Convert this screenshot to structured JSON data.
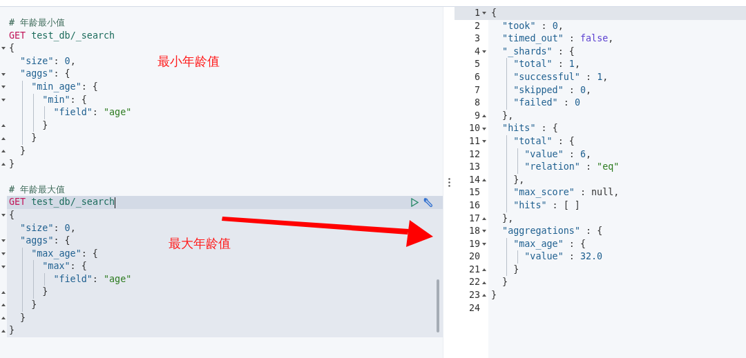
{
  "console": {
    "requests": [
      {
        "comment": "# 年龄最小值",
        "method": "GET",
        "path": "test_db/_search",
        "selected": false,
        "body": [
          [
            {
              "kind": "punct",
              "text": "{"
            }
          ],
          [
            {
              "kind": "key",
              "text": "\"size\""
            },
            {
              "kind": "punct",
              "text": ": "
            },
            {
              "kind": "number",
              "text": "0"
            },
            {
              "kind": "punct",
              "text": ","
            }
          ],
          [
            {
              "kind": "key",
              "text": "\"aggs\""
            },
            {
              "kind": "punct",
              "text": ": {"
            }
          ],
          [
            {
              "kind": "key",
              "text": "\"min_age\""
            },
            {
              "kind": "punct",
              "text": ": {"
            }
          ],
          [
            {
              "kind": "key",
              "text": "\"min\""
            },
            {
              "kind": "punct",
              "text": ": {"
            }
          ],
          [
            {
              "kind": "key",
              "text": "\"field\""
            },
            {
              "kind": "punct",
              "text": ": "
            },
            {
              "kind": "string",
              "text": "\"age\""
            }
          ],
          [
            {
              "kind": "punct",
              "text": "}"
            }
          ],
          [
            {
              "kind": "punct",
              "text": "}"
            }
          ],
          [
            {
              "kind": "punct",
              "text": "}"
            }
          ],
          [
            {
              "kind": "punct",
              "text": "}"
            }
          ]
        ]
      },
      {
        "comment": "# 年龄最大值",
        "method": "GET",
        "path": "test_db/_search",
        "selected": true,
        "body": [
          [
            {
              "kind": "punct",
              "text": "{"
            }
          ],
          [
            {
              "kind": "key",
              "text": "\"size\""
            },
            {
              "kind": "punct",
              "text": ": "
            },
            {
              "kind": "number",
              "text": "0"
            },
            {
              "kind": "punct",
              "text": ","
            }
          ],
          [
            {
              "kind": "key",
              "text": "\"aggs\""
            },
            {
              "kind": "punct",
              "text": ": {"
            }
          ],
          [
            {
              "kind": "key",
              "text": "\"max_age\""
            },
            {
              "kind": "punct",
              "text": ": {"
            }
          ],
          [
            {
              "kind": "key",
              "text": "\"max\""
            },
            {
              "kind": "punct",
              "text": ": {"
            }
          ],
          [
            {
              "kind": "key",
              "text": "\"field\""
            },
            {
              "kind": "punct",
              "text": ": "
            },
            {
              "kind": "string",
              "text": "\"age\""
            }
          ],
          [
            {
              "kind": "punct",
              "text": "}"
            }
          ],
          [
            {
              "kind": "punct",
              "text": "}"
            }
          ],
          [
            {
              "kind": "punct",
              "text": "}"
            }
          ],
          [
            {
              "kind": "punct",
              "text": "}"
            }
          ]
        ]
      }
    ]
  },
  "annotations": [
    {
      "text": "最小年龄值"
    },
    {
      "text": "最大年龄值"
    }
  ],
  "response": {
    "lines": [
      {
        "n": "1",
        "active": true,
        "tokens": [
          {
            "kind": "punct",
            "text": "{"
          }
        ]
      },
      {
        "n": "2",
        "active": false,
        "tokens": [
          {
            "kind": "key",
            "text": "\"took\""
          },
          {
            "kind": "punct",
            "text": " : "
          },
          {
            "kind": "number",
            "text": "0"
          },
          {
            "kind": "punct",
            "text": ","
          }
        ]
      },
      {
        "n": "3",
        "active": false,
        "tokens": [
          {
            "kind": "key",
            "text": "\"timed_out\""
          },
          {
            "kind": "punct",
            "text": " : "
          },
          {
            "kind": "bool",
            "text": "false"
          },
          {
            "kind": "punct",
            "text": ","
          }
        ]
      },
      {
        "n": "4",
        "active": false,
        "tokens": [
          {
            "kind": "key",
            "text": "\"_shards\""
          },
          {
            "kind": "punct",
            "text": " : {"
          }
        ]
      },
      {
        "n": "5",
        "active": false,
        "tokens": [
          {
            "kind": "key",
            "text": "\"total\""
          },
          {
            "kind": "punct",
            "text": " : "
          },
          {
            "kind": "number",
            "text": "1"
          },
          {
            "kind": "punct",
            "text": ","
          }
        ]
      },
      {
        "n": "6",
        "active": false,
        "tokens": [
          {
            "kind": "key",
            "text": "\"successful\""
          },
          {
            "kind": "punct",
            "text": " : "
          },
          {
            "kind": "number",
            "text": "1"
          },
          {
            "kind": "punct",
            "text": ","
          }
        ]
      },
      {
        "n": "7",
        "active": false,
        "tokens": [
          {
            "kind": "key",
            "text": "\"skipped\""
          },
          {
            "kind": "punct",
            "text": " : "
          },
          {
            "kind": "number",
            "text": "0"
          },
          {
            "kind": "punct",
            "text": ","
          }
        ]
      },
      {
        "n": "8",
        "active": false,
        "tokens": [
          {
            "kind": "key",
            "text": "\"failed\""
          },
          {
            "kind": "punct",
            "text": " : "
          },
          {
            "kind": "number",
            "text": "0"
          }
        ]
      },
      {
        "n": "9",
        "active": false,
        "tokens": [
          {
            "kind": "punct",
            "text": "},"
          }
        ]
      },
      {
        "n": "10",
        "active": false,
        "tokens": [
          {
            "kind": "key",
            "text": "\"hits\""
          },
          {
            "kind": "punct",
            "text": " : {"
          }
        ]
      },
      {
        "n": "11",
        "active": false,
        "tokens": [
          {
            "kind": "key",
            "text": "\"total\""
          },
          {
            "kind": "punct",
            "text": " : {"
          }
        ]
      },
      {
        "n": "12",
        "active": false,
        "tokens": [
          {
            "kind": "key",
            "text": "\"value\""
          },
          {
            "kind": "punct",
            "text": " : "
          },
          {
            "kind": "number",
            "text": "6"
          },
          {
            "kind": "punct",
            "text": ","
          }
        ]
      },
      {
        "n": "13",
        "active": false,
        "tokens": [
          {
            "kind": "key",
            "text": "\"relation\""
          },
          {
            "kind": "punct",
            "text": " : "
          },
          {
            "kind": "string",
            "text": "\"eq\""
          }
        ]
      },
      {
        "n": "14",
        "active": false,
        "tokens": [
          {
            "kind": "punct",
            "text": "},"
          }
        ]
      },
      {
        "n": "15",
        "active": false,
        "tokens": [
          {
            "kind": "key",
            "text": "\"max_score\""
          },
          {
            "kind": "punct",
            "text": " : "
          },
          {
            "kind": "null",
            "text": "null"
          },
          {
            "kind": "punct",
            "text": ","
          }
        ]
      },
      {
        "n": "16",
        "active": false,
        "tokens": [
          {
            "kind": "key",
            "text": "\"hits\""
          },
          {
            "kind": "punct",
            "text": " : [ ]"
          }
        ]
      },
      {
        "n": "17",
        "active": false,
        "tokens": [
          {
            "kind": "punct",
            "text": "},"
          }
        ]
      },
      {
        "n": "18",
        "active": false,
        "tokens": [
          {
            "kind": "key",
            "text": "\"aggregations\""
          },
          {
            "kind": "punct",
            "text": " : {"
          }
        ]
      },
      {
        "n": "19",
        "active": false,
        "tokens": [
          {
            "kind": "key",
            "text": "\"max_age\""
          },
          {
            "kind": "punct",
            "text": " : {"
          }
        ]
      },
      {
        "n": "20",
        "active": false,
        "tokens": [
          {
            "kind": "key",
            "text": "\"value\""
          },
          {
            "kind": "punct",
            "text": " : "
          },
          {
            "kind": "number",
            "text": "32.0"
          }
        ]
      },
      {
        "n": "21",
        "active": false,
        "tokens": [
          {
            "kind": "punct",
            "text": "}"
          }
        ]
      },
      {
        "n": "22",
        "active": false,
        "tokens": [
          {
            "kind": "punct",
            "text": "}"
          }
        ]
      },
      {
        "n": "23",
        "active": false,
        "tokens": [
          {
            "kind": "punct",
            "text": "}"
          }
        ]
      },
      {
        "n": "24",
        "active": false
      }
    ]
  }
}
